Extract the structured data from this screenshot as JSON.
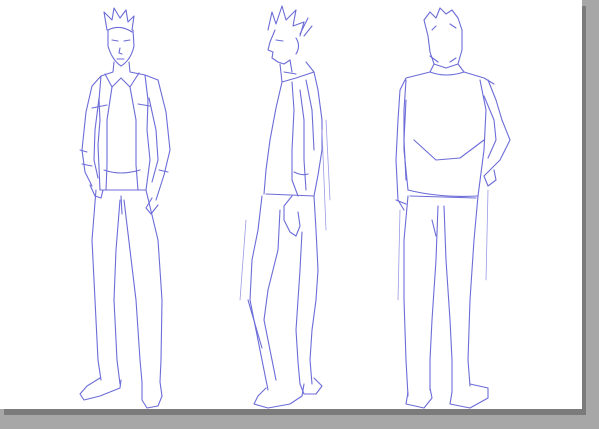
{
  "canvas": {
    "background": "#ffffff",
    "pasteboard": "#a7a7a7",
    "shadow": "#7b7b7b"
  },
  "artwork": {
    "stroke_color": "#6c6cd8",
    "stroke_color_light": "#9a9ae6",
    "figures": [
      {
        "view": "front-view",
        "icon": "character-front-sketch"
      },
      {
        "view": "side-view",
        "icon": "character-side-sketch"
      },
      {
        "view": "back-view",
        "icon": "character-back-sketch"
      }
    ]
  }
}
